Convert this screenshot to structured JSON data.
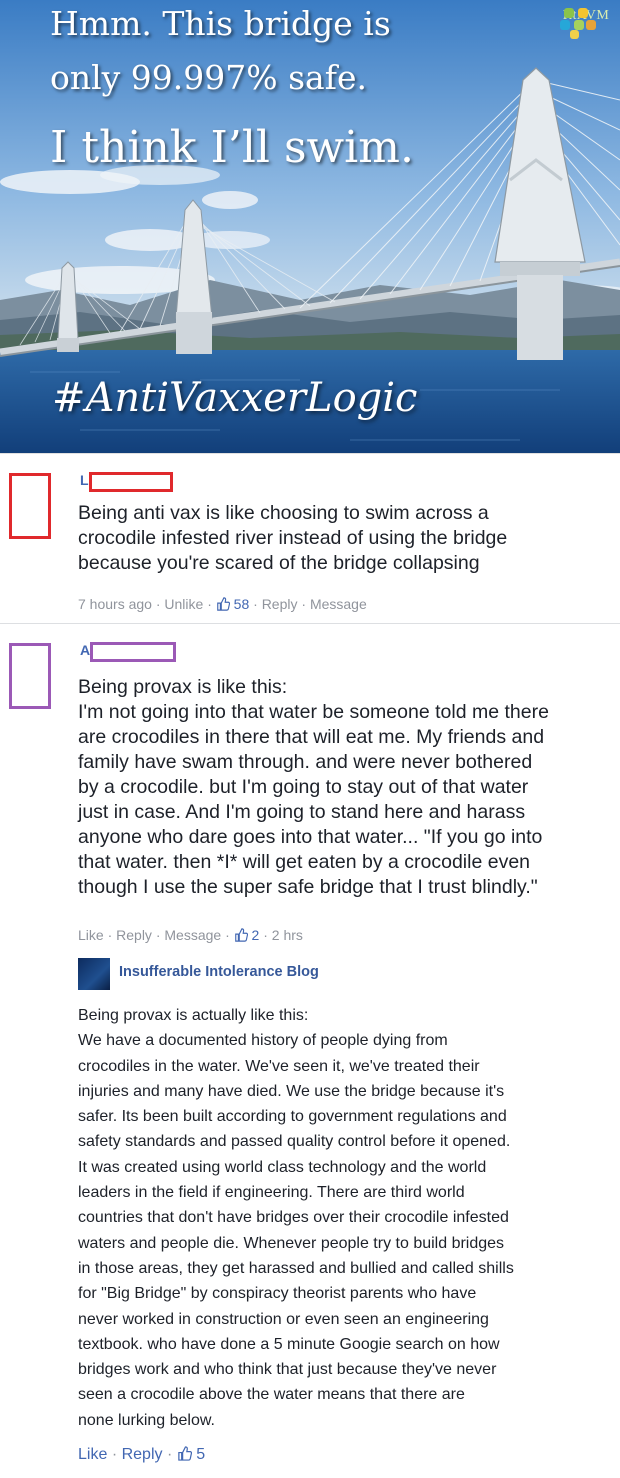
{
  "meme": {
    "line1": "Hmm. This bridge is",
    "line2": "only 99.997% safe.",
    "line3": "I think I’ll swim.",
    "hashtag": "#AntiVaxxerLogic",
    "brand": "RtAVM"
  },
  "comment1": {
    "author_initial": "L",
    "lines": [
      "Being anti vax is like choosing to swim across a",
      "crocodile infested river instead of using the bridge",
      "because you're scared of the bridge collapsing"
    ],
    "time": "7 hours ago",
    "unlike": "Unlike",
    "likes": "58",
    "reply": "Reply",
    "message": "Message"
  },
  "comment2": {
    "author_initial": "A",
    "lines": [
      "Being provax is like this:",
      "I'm not going into that water be someone told me there",
      "are crocodiles in there that will eat me. My friends and",
      "family have swam through. and were never bothered",
      "by a crocodile. but I'm going to stay out of that water",
      "just in case. And I'm going to stand here and harass",
      "anyone who dare goes into that water... \"If you go into",
      "that water. then *I* will get eaten by a crocodile even",
      "though I use the super safe bridge that I trust blindly.\""
    ],
    "like": "Like",
    "reply": "Reply",
    "message": "Message",
    "likes": "2",
    "time": "2 hrs"
  },
  "reply": {
    "author": "Insufferable Intolerance Blog",
    "lines": [
      "Being provax is actually like this:",
      "We have a documented history of people dying from",
      "crocodiles in the water. We've seen it, we've treated their",
      "injuries and many have died. We use the bridge because it's",
      "safer. Its been built according to government regulations and",
      "safety standards and passed quality control before it opened.",
      "It was created using world class technology and the world",
      "leaders in the field if engineering. There are third world",
      "countries that don't have bridges over their crocodile infested",
      "waters and people die. Whenever people try to build bridges",
      "in those areas, they get harassed and bullied and called shills",
      "for \"Big Bridge\" by conspiracy theorist parents who have",
      "never worked in construction or even seen an engineering",
      "textbook. who have done a 5 minute Googie search on how",
      "bridges work and who think that just because they've never",
      "seen a crocodile above the water means that there are",
      "none lurking below."
    ],
    "like": "Like",
    "reply": "Reply",
    "likes": "5"
  },
  "colors": {
    "link_blue": "#4267b2",
    "meta_gray": "#90949c",
    "redact_red": "#e0292c",
    "redact_purple": "#9b59b6"
  }
}
